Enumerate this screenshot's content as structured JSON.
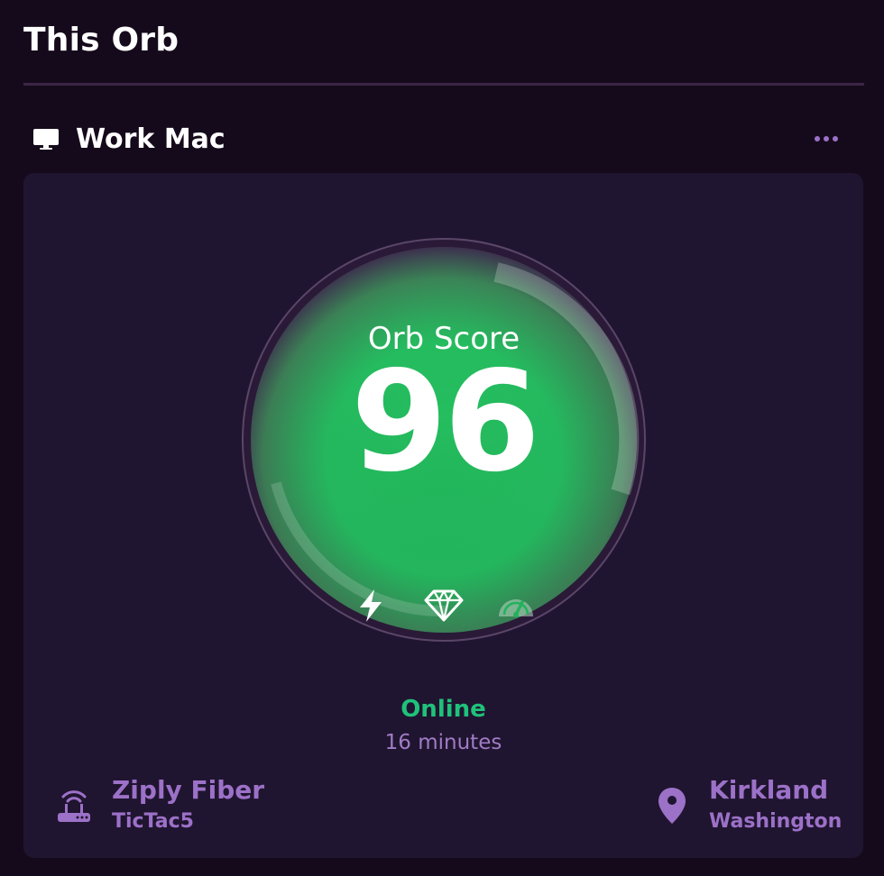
{
  "page": {
    "title": "This Orb"
  },
  "device": {
    "icon": "monitor-icon",
    "name": "Work Mac",
    "more_icon": "more-dots-icon"
  },
  "orb": {
    "label": "Orb Score",
    "score": "96",
    "score_value": 96,
    "indicators": [
      "bolt-icon",
      "diamond-icon",
      "speedometer-icon"
    ]
  },
  "status": {
    "state": "Online",
    "uptime": "16 minutes"
  },
  "network": {
    "icon": "router-icon",
    "isp": "Ziply Fiber",
    "ssid": "TicTac5"
  },
  "location": {
    "icon": "map-pin-icon",
    "city": "Kirkland",
    "region": "Washington"
  },
  "colors": {
    "background": "#150a1b",
    "card": "#201530",
    "accent": "#9c71c8",
    "online": "#1fc27a",
    "orb_green": "#22b05a"
  }
}
